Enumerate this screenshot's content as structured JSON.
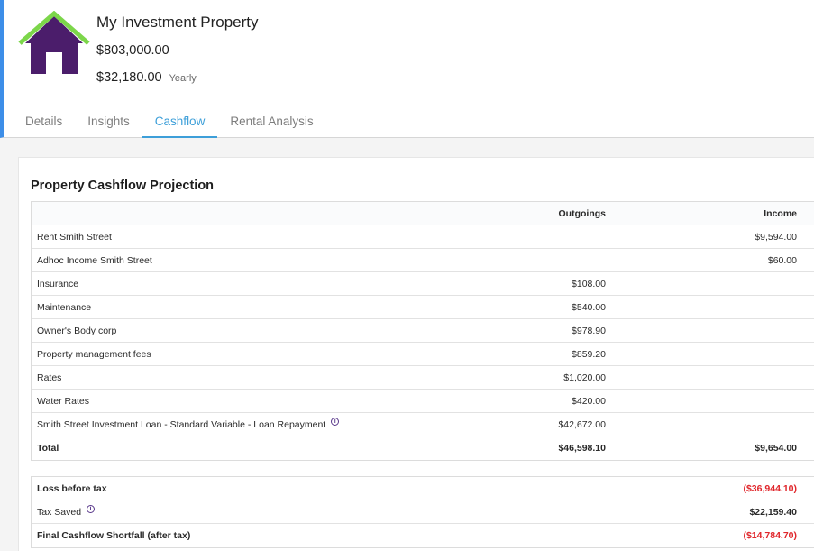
{
  "property": {
    "name": "My Investment Property",
    "value": "$803,000.00",
    "yearly_amount": "$32,180.00",
    "yearly_label": "Yearly",
    "icon": "house-icon",
    "colors": {
      "house_body": "#4b1d6b",
      "roof": "#7cd64a",
      "accent": "#3d8ee8"
    }
  },
  "tabs": [
    {
      "label": "Details",
      "active": false
    },
    {
      "label": "Insights",
      "active": false
    },
    {
      "label": "Cashflow",
      "active": true
    },
    {
      "label": "Rental Analysis",
      "active": false
    }
  ],
  "cashflow": {
    "title": "Property Cashflow Projection",
    "columns": {
      "outgoings": "Outgoings",
      "income": "Income"
    },
    "rows": [
      {
        "label": "Rent Smith Street",
        "outgoings": "",
        "income": "$9,594.00"
      },
      {
        "label": "Adhoc Income Smith Street",
        "outgoings": "",
        "income": "$60.00"
      },
      {
        "label": "Insurance",
        "outgoings": "$108.00",
        "income": ""
      },
      {
        "label": "Maintenance",
        "outgoings": "$540.00",
        "income": ""
      },
      {
        "label": "Owner's Body corp",
        "outgoings": "$978.90",
        "income": ""
      },
      {
        "label": "Property management fees",
        "outgoings": "$859.20",
        "income": ""
      },
      {
        "label": "Rates",
        "outgoings": "$1,020.00",
        "income": ""
      },
      {
        "label": "Water Rates",
        "outgoings": "$420.00",
        "income": ""
      },
      {
        "label": "Smith Street Investment Loan - Standard Variable - Loan Repayment",
        "outgoings": "$42,672.00",
        "income": ""
      }
    ],
    "total": {
      "label": "Total",
      "outgoings": "$46,598.10",
      "income": "$9,654.00"
    },
    "summary": [
      {
        "label": "Loss before tax",
        "value": "($36,944.10)"
      },
      {
        "label": "Tax Saved",
        "value": "$22,159.40"
      },
      {
        "label": "Final Cashflow Shortfall (after tax)",
        "value": "($14,784.70)"
      }
    ],
    "negative_color": "#e0262b"
  }
}
